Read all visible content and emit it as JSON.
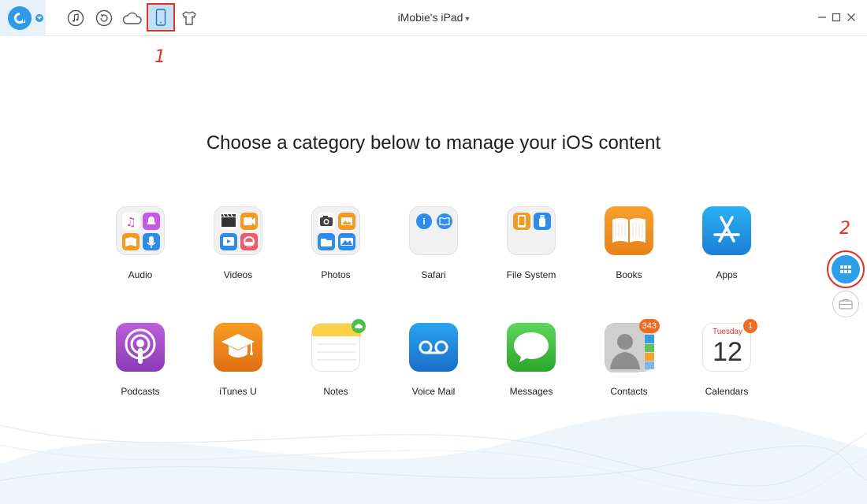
{
  "app": {
    "device_title": "iMobie's iPad",
    "caret": "⌄",
    "logo_letter": "A"
  },
  "toolbar": {
    "icons": [
      "music-icon",
      "backup-restore-icon",
      "cloud-icon",
      "device-icon",
      "tshirt-icon"
    ]
  },
  "annotations": {
    "step1": "1",
    "step2": "2"
  },
  "main": {
    "headline": "Choose a category below to manage your iOS content"
  },
  "categories": [
    {
      "label": "Audio"
    },
    {
      "label": "Videos"
    },
    {
      "label": "Photos"
    },
    {
      "label": "Safari"
    },
    {
      "label": "File System"
    },
    {
      "label": "Books"
    },
    {
      "label": "Apps"
    },
    {
      "label": "Podcasts"
    },
    {
      "label": "iTunes U"
    },
    {
      "label": "Notes"
    },
    {
      "label": "Voice Mail"
    },
    {
      "label": "Messages"
    },
    {
      "label": "Contacts",
      "badge": "343"
    },
    {
      "label": "Calendars",
      "badge": "1",
      "weekday": "Tuesday",
      "day": "12"
    }
  ],
  "colors": {
    "accent": "#2e9ee9",
    "annotation_red": "#e5311f",
    "badge_orange": "#f26b21"
  }
}
